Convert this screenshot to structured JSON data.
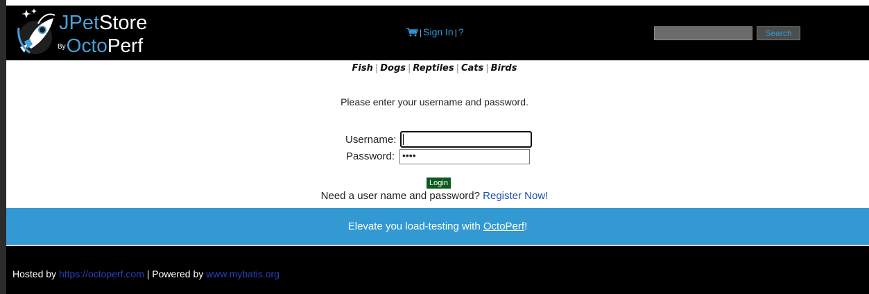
{
  "header": {
    "brand_line1_a": "J",
    "brand_line1_b": "Pet",
    "brand_line1_c": "Store",
    "brand_by": "By",
    "brand_line2_a": "Octo",
    "brand_line2_b": "Perf",
    "cart_icon": "shopping-cart-icon",
    "sign_in": "Sign In",
    "help": "?",
    "search_button": "Search",
    "search_value": ""
  },
  "quicklinks": [
    "Fish",
    "Dogs",
    "Reptiles",
    "Cats",
    "Birds"
  ],
  "login": {
    "prompt": "Please enter your username and password.",
    "username_label": "Username:",
    "username_value": "",
    "password_label": "Password:",
    "password_mask": "••••",
    "login_button": "Login",
    "register_text": "Need a user name and password?",
    "register_link": "Register Now!"
  },
  "banner": {
    "text_before": "Elevate you load-testing with",
    "link": "OctoPerf",
    "text_after": "!"
  },
  "footer": {
    "hosted_by": "Hosted by",
    "hosted_link": "https://octoperf.com",
    "powered_sep": " | Powered by ",
    "powered_link": "www.mybatis.org"
  },
  "colors": {
    "header_bg": "#000000",
    "link_blue": "#2f9bdc",
    "banner_bg": "#3299d3",
    "login_button": "#0c5a1d"
  }
}
